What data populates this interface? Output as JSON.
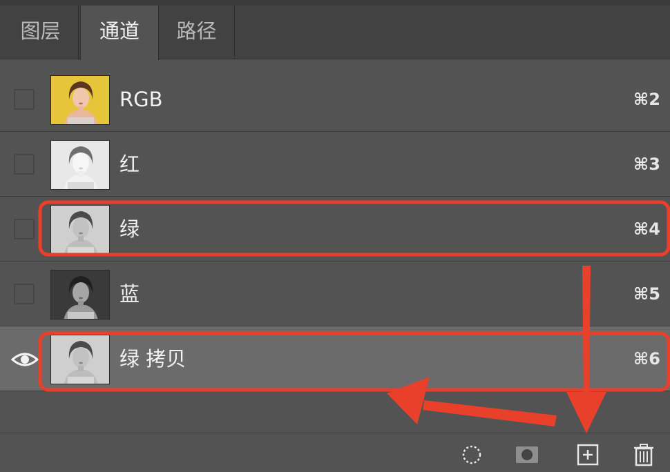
{
  "tabs": [
    {
      "label": "图层"
    },
    {
      "label": "通道"
    },
    {
      "label": "路径"
    }
  ],
  "active_tab": "通道",
  "channels": [
    {
      "name": "RGB",
      "shortcut": "⌘2",
      "visible": false,
      "thumbnail": "color-portrait"
    },
    {
      "name": "红",
      "shortcut": "⌘3",
      "visible": false,
      "thumbnail": "light-gray-portrait"
    },
    {
      "name": "绿",
      "shortcut": "⌘4",
      "visible": false,
      "thumbnail": "gray-portrait"
    },
    {
      "name": "蓝",
      "shortcut": "⌘5",
      "visible": false,
      "thumbnail": "dark-gray-portrait"
    },
    {
      "name": "绿 拷贝",
      "shortcut": "⌘6",
      "visible": true,
      "selected": true,
      "thumbnail": "gray-portrait"
    }
  ],
  "bottom_icons": [
    "load-selection-icon",
    "save-selection-mask-icon",
    "new-channel-icon",
    "trash-icon"
  ],
  "colors": {
    "panel_bg": "#535353",
    "tab_bar_bg": "#424242",
    "selected_row_bg": "#6b6b6b",
    "annotation_red": "#e8402a"
  }
}
